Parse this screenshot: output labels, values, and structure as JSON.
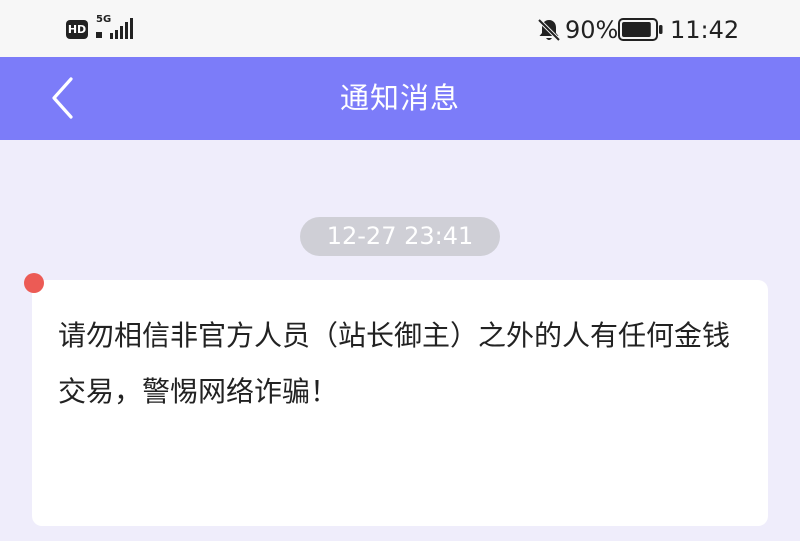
{
  "status_bar": {
    "hd_label": "HD",
    "network_label": "5G",
    "battery_percent": "90%",
    "battery_level": 0.9,
    "time": "11:42",
    "icons": [
      "signal-icon",
      "mute-bell-icon",
      "battery-icon"
    ]
  },
  "nav": {
    "title": "通知消息",
    "back_icon": "chevron-left-icon",
    "background": "#7c7cf9"
  },
  "message": {
    "timestamp": "12-27 23:41",
    "unread": true,
    "unread_color": "#ec5b55",
    "text": "请勿相信非官方人员（站长御主）之外的人有任何金钱交易，警惕网络诈骗！"
  }
}
